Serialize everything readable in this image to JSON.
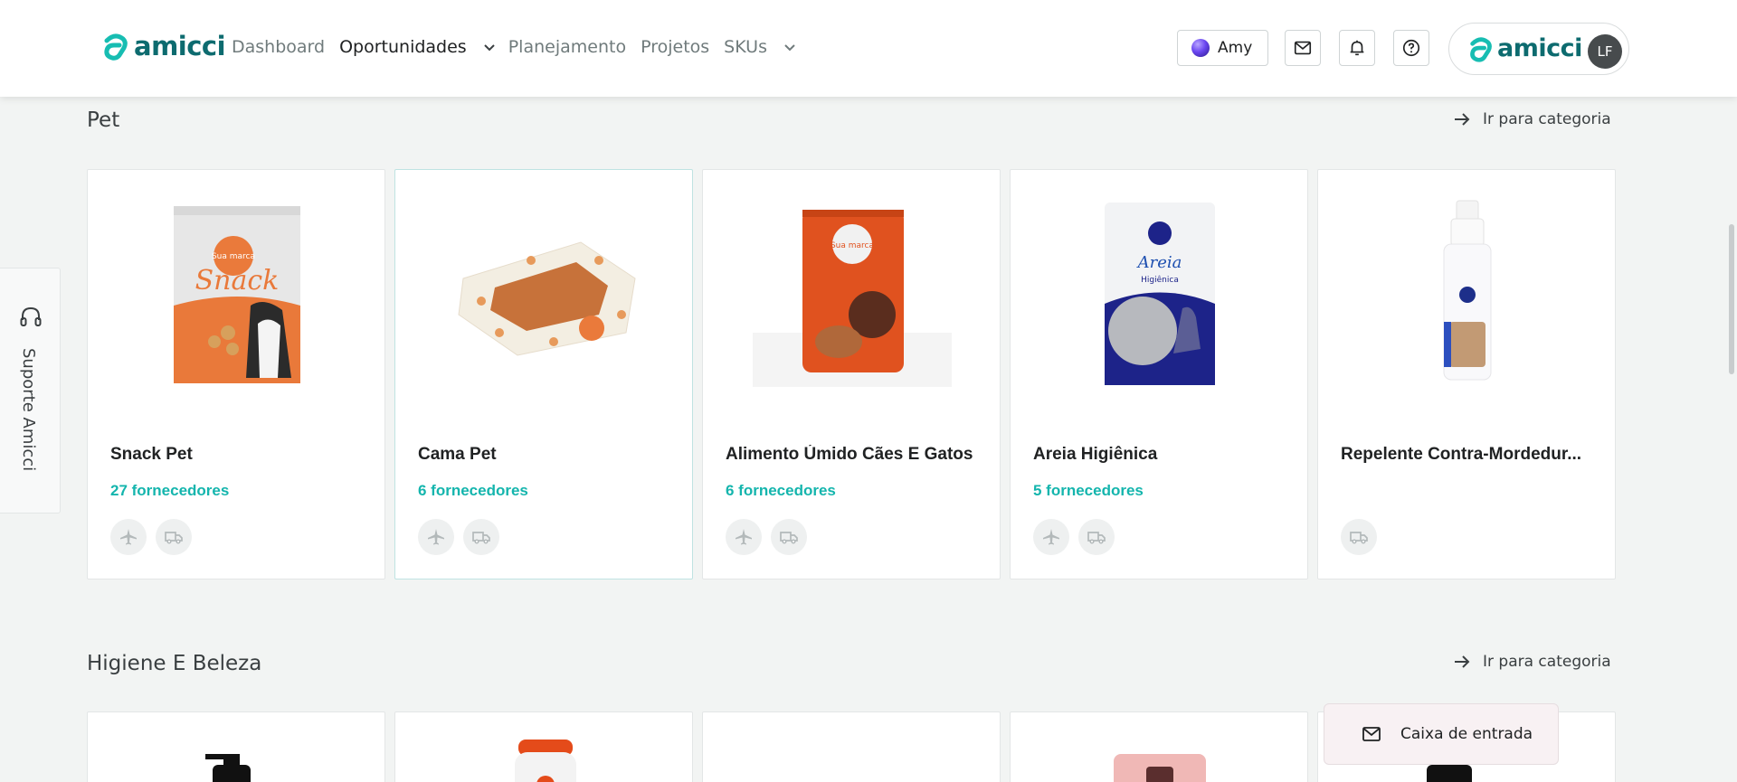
{
  "header": {
    "logo_text": "amicci",
    "nav": {
      "dashboard": "Dashboard",
      "oportunidades": "Oportunidades",
      "planejamento": "Planejamento",
      "projetos": "Projetos",
      "skus": "SKUs"
    },
    "amy_label": "Amy",
    "profile_logo_text": "amicci",
    "avatar_initials": "LF"
  },
  "support": {
    "label": "Suporte Amicci"
  },
  "sections": [
    {
      "title": "Pet",
      "goto_label": "Ir para categoria",
      "products": [
        {
          "name": "Snack Pet",
          "suppliers": "27 fornecedores",
          "icons": [
            "airplane-icon",
            "truck-icon"
          ]
        },
        {
          "name": "Cama Pet",
          "suppliers": "6 fornecedores",
          "icons": [
            "airplane-icon",
            "truck-icon"
          ]
        },
        {
          "name": "Alimento Úmido Cães E Gatos",
          "suppliers": "6 fornecedores",
          "icons": [
            "airplane-icon",
            "truck-icon"
          ]
        },
        {
          "name": "Areia Higiênica",
          "suppliers": "5 fornecedores",
          "icons": [
            "airplane-icon",
            "truck-icon"
          ]
        },
        {
          "name": "Repelente Contra-Mordedur...",
          "suppliers": "",
          "icons": [
            "truck-icon"
          ]
        }
      ]
    },
    {
      "title": "Higiene E Beleza",
      "goto_label": "Ir para categoria"
    }
  ],
  "inbox": {
    "label": "Caixa de entrada"
  },
  "colors": {
    "brand": "#0d6b6f",
    "accent": "#14b5ad",
    "background": "#f2f4f3"
  },
  "product_images": {
    "pack_brand_text": "Sua marca",
    "snack_word": "Snack",
    "areia_word": "Areia",
    "areia_sub": "Higiênica"
  }
}
